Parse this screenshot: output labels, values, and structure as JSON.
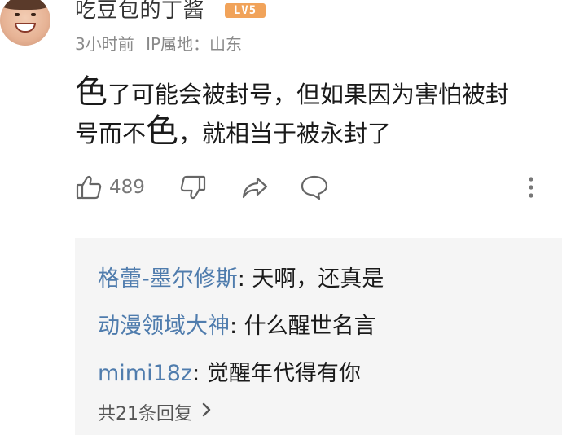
{
  "header": {
    "username": "吃豆包的丁酱",
    "level_badge": "LV5",
    "time_ago": "3小时前",
    "ip_location": "IP属地：山东"
  },
  "comment": {
    "part1_emph": "色",
    "part1_rest": "了可能会被封号，但如果因为害怕被封",
    "part2_start": "号而不",
    "part2_emph": "色",
    "part2_rest": "，就相当于被永封了"
  },
  "actions": {
    "like_count": "489",
    "icons": [
      "thumbs-up-icon",
      "thumbs-down-icon",
      "share-icon",
      "reply-icon",
      "more-vertical-icon"
    ]
  },
  "replies": {
    "items": [
      {
        "name": "格蕾-墨尔修斯",
        "text": ": 天啊，还真是"
      },
      {
        "name": "动漫领域大神",
        "text": ": 什么醒世名言"
      },
      {
        "name": "mimi18z",
        "text": ": 觉醒年代得有你"
      }
    ],
    "more_label": "共21条回复"
  },
  "colors": {
    "reply_name": "#4f7cad",
    "badge": "#f1a35a",
    "meta_text": "#8a8a8a",
    "reply_bg": "#f5f5f5"
  }
}
